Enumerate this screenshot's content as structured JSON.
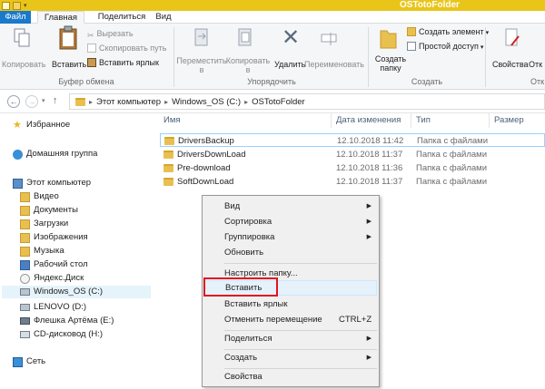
{
  "window": {
    "title": "OSTotoFolder"
  },
  "tabs": {
    "file": "Файл",
    "home": "Главная",
    "share": "Поделиться",
    "view": "Вид"
  },
  "ribbon": {
    "copy": "Копировать",
    "paste": "Вставить",
    "cut": "Вырезать",
    "copy_path": "Скопировать путь",
    "paste_shortcut": "Вставить ярлык",
    "move_to": "Переместить в",
    "copy_to": "Копировать в",
    "delete": "Удалить",
    "rename": "Переименовать",
    "new_folder": "Создать папку",
    "new_item": "Создать элемент",
    "easy_access": "Простой доступ",
    "properties": "Свойства",
    "open_partial": "Отк",
    "groups": {
      "clipboard": "Буфер обмена",
      "organize": "Упорядочить",
      "create": "Создать",
      "open_partial": "Отк"
    }
  },
  "address": {
    "crumbs": [
      "Этот компьютер",
      "Windows_OS (C:)",
      "OSTotoFolder"
    ]
  },
  "sidebar": {
    "favorites": "Избранное",
    "homegroup": "Домашняя группа",
    "this_pc": "Этот компьютер",
    "items": [
      "Видео",
      "Документы",
      "Загрузки",
      "Изображения",
      "Музыка",
      "Рабочий стол",
      "Яндекс.Диск",
      "Windows_OS (C:)",
      "LENOVO (D:)",
      "Флешка Артёма (E:)",
      "CD-дисковод (H:)"
    ],
    "network": "Сеть"
  },
  "columns": {
    "name": "Имя",
    "date": "Дата изменения",
    "type": "Тип",
    "size": "Размер"
  },
  "files": [
    {
      "name": "DriversBackup",
      "date": "12.10.2018 11:42",
      "type": "Папка с файлами"
    },
    {
      "name": "DriversDownLoad",
      "date": "12.10.2018 11:37",
      "type": "Папка с файлами"
    },
    {
      "name": "Pre-download",
      "date": "12.10.2018 11:36",
      "type": "Папка с файлами"
    },
    {
      "name": "SoftDownLoad",
      "date": "12.10.2018 11:37",
      "type": "Папка с файлами"
    }
  ],
  "context_menu": {
    "view": "Вид",
    "sort": "Сортировка",
    "group": "Группировка",
    "refresh": "Обновить",
    "customize": "Настроить папку...",
    "paste": "Вставить",
    "paste_shortcut": "Вставить ярлык",
    "undo_move": "Отменить перемещение",
    "undo_shortcut": "CTRL+Z",
    "share": "Поделиться",
    "new": "Создать",
    "properties": "Свойства"
  },
  "colors": {
    "accent": "#1979ca",
    "title_bar": "#e9c51a",
    "highlight_box": "#e0141e"
  }
}
